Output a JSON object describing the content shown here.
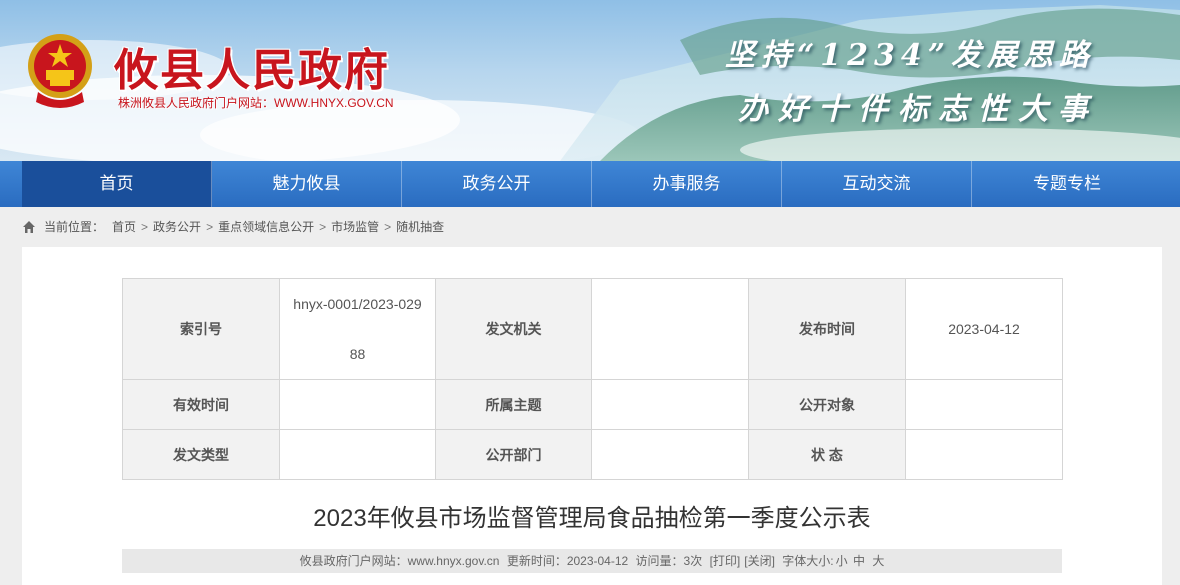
{
  "header": {
    "site_title": "攸县人民政府",
    "site_url": "株洲攸县人民政府门户网站：WWW.HNYX.GOV.CN",
    "slogan_line1": "坚持“1234”发展思路",
    "slogan_line2": "办好十件标志性大事",
    "emblem_icon": "national-emblem-icon",
    "colors": {
      "title_red": "#c8151d",
      "nav_blue": "#2a6cc0",
      "nav_active": "#1a4f9b"
    }
  },
  "nav": {
    "items": [
      "首页",
      "魅力攸县",
      "政务公开",
      "办事服务",
      "互动交流",
      "专题专栏"
    ],
    "active_index": 0
  },
  "breadcrumb": {
    "icon": "home-icon",
    "prefix": "当前位置：",
    "items": [
      "首页",
      "政务公开",
      "重点领域信息公开",
      "市场监管",
      "随机抽查"
    ],
    "separator": ">"
  },
  "meta_table": {
    "index_label": "索引号",
    "index_value": "hnyx-0001/2023-02988",
    "issuer_label": "发文机关",
    "issuer_value": "",
    "publish_label": "发布时间",
    "publish_value": "2023-04-12",
    "valid_label": "有效时间",
    "valid_value": "",
    "topic_label": "所属主题",
    "topic_value": "",
    "audience_label": "公开对象",
    "audience_value": "",
    "doctype_label": "发文类型",
    "doctype_value": "",
    "dept_label": "公开部门",
    "dept_value": "",
    "status_label": "状 态",
    "status_value": ""
  },
  "article": {
    "title": "2023年攸县市场监督管理局食品抽检第一季度公示表"
  },
  "info_bar": {
    "site_label": "攸县政府门户网站：www.hnyx.gov.cn",
    "updated_label": "更新时间：2023-04-12",
    "views_label": "访问量：3次",
    "print": "[打印]",
    "close": "[关闭]",
    "font_size_label": "字体大小:",
    "font_small": "小",
    "font_medium": "中",
    "font_large": "大"
  }
}
